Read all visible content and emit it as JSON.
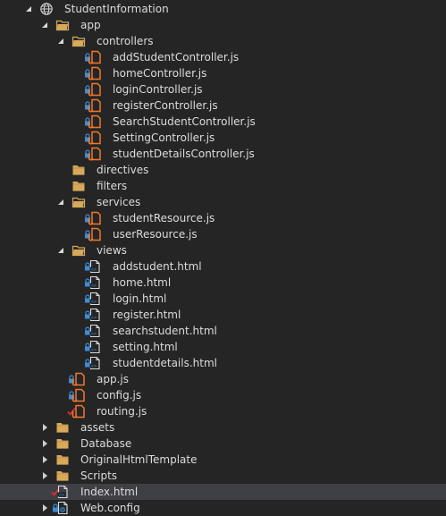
{
  "colors": {
    "background": "#252526",
    "selected_row": "#3f3f46",
    "text": "#dcdcdc",
    "folder": "#d7a95a",
    "js_icon": "#f0772a",
    "lock": "#3c8dd6",
    "check": "#e0312f"
  },
  "tree": [
    {
      "label": "StudentInformation",
      "level": 0,
      "icon": "globe-icon",
      "expand": "expanded",
      "status": ""
    },
    {
      "label": "app",
      "level": 1,
      "icon": "folder-open-icon",
      "expand": "expanded",
      "status": ""
    },
    {
      "label": "controllers",
      "level": 2,
      "icon": "folder-open-icon",
      "expand": "expanded",
      "status": ""
    },
    {
      "label": "addStudentController.js",
      "level": 3,
      "icon": "js-file-icon",
      "expand": "",
      "status": "lock"
    },
    {
      "label": "homeController.js",
      "level": 3,
      "icon": "js-file-icon",
      "expand": "",
      "status": "lock"
    },
    {
      "label": "loginController.js",
      "level": 3,
      "icon": "js-file-icon",
      "expand": "",
      "status": "lock"
    },
    {
      "label": "registerController.js",
      "level": 3,
      "icon": "js-file-icon",
      "expand": "",
      "status": "lock"
    },
    {
      "label": "SearchStudentController.js",
      "level": 3,
      "icon": "js-file-icon",
      "expand": "",
      "status": "lock"
    },
    {
      "label": "SettingController.js",
      "level": 3,
      "icon": "js-file-icon",
      "expand": "",
      "status": "lock"
    },
    {
      "label": "studentDetailsController.js",
      "level": 3,
      "icon": "js-file-icon",
      "expand": "",
      "status": "lock"
    },
    {
      "label": "directives",
      "level": 2,
      "icon": "folder-icon",
      "expand": "",
      "status": ""
    },
    {
      "label": "filters",
      "level": 2,
      "icon": "folder-icon",
      "expand": "",
      "status": ""
    },
    {
      "label": "services",
      "level": 2,
      "icon": "folder-open-icon",
      "expand": "expanded",
      "status": ""
    },
    {
      "label": "studentResource.js",
      "level": 3,
      "icon": "js-file-icon",
      "expand": "",
      "status": "lock"
    },
    {
      "label": "userResource.js",
      "level": 3,
      "icon": "js-file-icon",
      "expand": "",
      "status": "lock"
    },
    {
      "label": "views",
      "level": 2,
      "icon": "folder-open-icon",
      "expand": "expanded",
      "status": ""
    },
    {
      "label": "addstudent.html",
      "level": 3,
      "icon": "html-file-icon",
      "expand": "",
      "status": "lock"
    },
    {
      "label": "home.html",
      "level": 3,
      "icon": "html-file-icon",
      "expand": "",
      "status": "lock"
    },
    {
      "label": "login.html",
      "level": 3,
      "icon": "html-file-icon",
      "expand": "",
      "status": "lock"
    },
    {
      "label": "register.html",
      "level": 3,
      "icon": "html-file-icon",
      "expand": "",
      "status": "lock"
    },
    {
      "label": "searchstudent.html",
      "level": 3,
      "icon": "html-file-icon",
      "expand": "",
      "status": "lock"
    },
    {
      "label": "setting.html",
      "level": 3,
      "icon": "html-file-icon",
      "expand": "",
      "status": "lock"
    },
    {
      "label": "studentdetails.html",
      "level": 3,
      "icon": "html-file-icon",
      "expand": "",
      "status": "lock"
    },
    {
      "label": "app.js",
      "level": 2,
      "icon": "js-file-icon",
      "expand": "",
      "status": "lock"
    },
    {
      "label": "config.js",
      "level": 2,
      "icon": "js-file-icon",
      "expand": "",
      "status": "lock"
    },
    {
      "label": "routing.js",
      "level": 2,
      "icon": "js-file-icon",
      "expand": "",
      "status": "check"
    },
    {
      "label": "assets",
      "level": 1,
      "icon": "folder-icon",
      "expand": "collapsed",
      "status": ""
    },
    {
      "label": "Database",
      "level": 1,
      "icon": "folder-icon",
      "expand": "collapsed",
      "status": ""
    },
    {
      "label": "OriginalHtmlTemplate",
      "level": 1,
      "icon": "folder-icon",
      "expand": "collapsed",
      "status": ""
    },
    {
      "label": "Scripts",
      "level": 1,
      "icon": "folder-icon",
      "expand": "collapsed",
      "status": ""
    },
    {
      "label": "Index.html",
      "level": 1,
      "icon": "html-file-icon",
      "expand": "",
      "status": "check",
      "selected": true
    },
    {
      "label": "Web.config",
      "level": 1,
      "icon": "config-file-icon",
      "expand": "collapsed",
      "status": "lock"
    }
  ]
}
